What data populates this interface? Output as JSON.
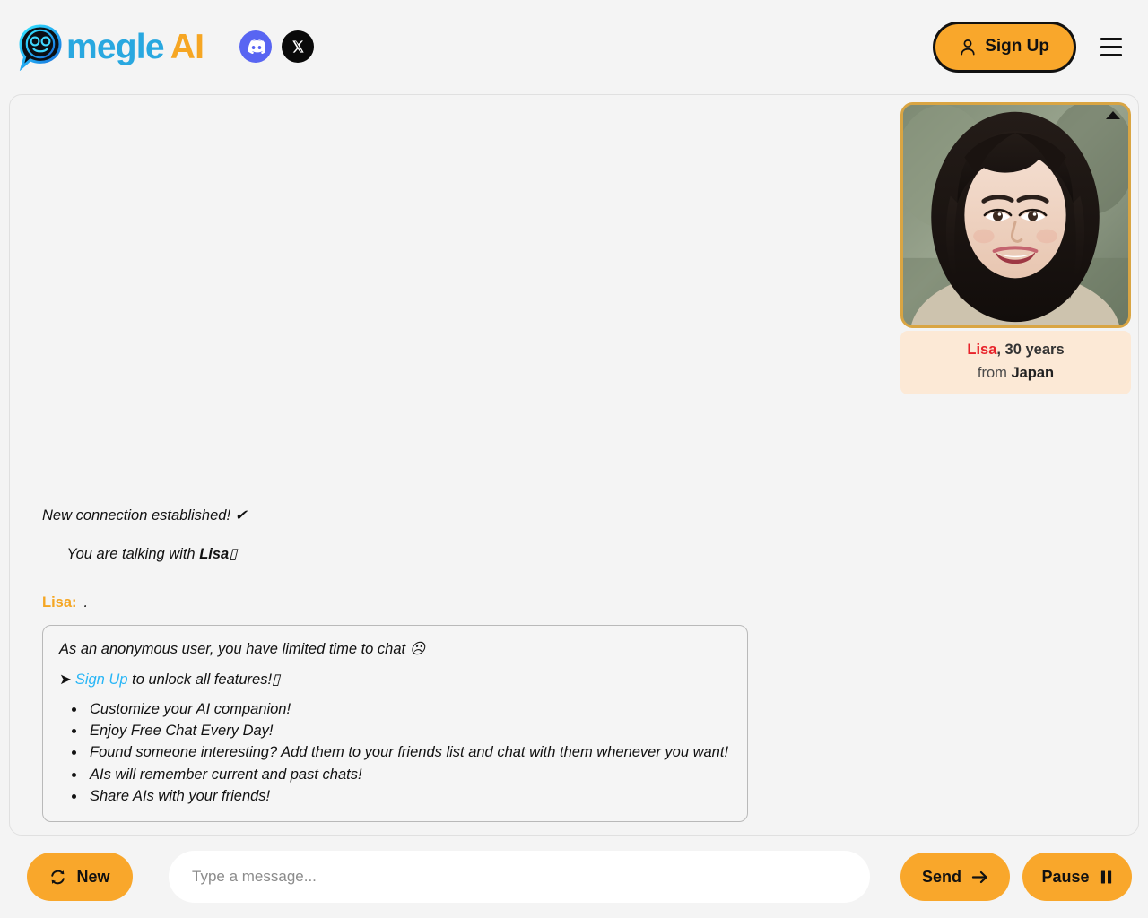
{
  "header": {
    "brand": {
      "logo_icon": "omegle-smiley-speech-bubble-logo",
      "word_primary": "megle",
      "word_accent": "AI"
    },
    "socials": [
      {
        "name": "discord",
        "icon": "discord-icon",
        "label": "Discord"
      },
      {
        "name": "x",
        "icon": "x-twitter-icon",
        "label": "X"
      }
    ],
    "signup": {
      "label": "Sign Up",
      "icon": "user-icon"
    },
    "menu_icon": "hamburger-menu-icon"
  },
  "profile": {
    "photo_alt": "Lisa profile photo",
    "collapse_icon": "triangle-up-icon",
    "name": "Lisa",
    "age_text": ", 30 years",
    "from_prefix": "from ",
    "country": "Japan"
  },
  "chat": {
    "system_line_1": "New connection established! ✔",
    "system_line_2_prefix": "You are talking with ",
    "system_line_2_name": "Lisa",
    "system_line_2_suffix": "▯",
    "peer_label": "Lisa:",
    "peer_message": ".",
    "info_box": {
      "headline": "As an anonymous user, you have limited time to chat ☹",
      "cta_arrow": "➤",
      "cta_link": "Sign Up",
      "cta_rest": " to unlock all features!▯",
      "features": [
        "Customize your AI companion!",
        "Enjoy Free Chat Every Day!",
        "Found someone interesting? Add them to your friends list and chat with them whenever you want!",
        "AIs will remember current and past chats!",
        "Share AIs with your friends!"
      ]
    }
  },
  "controls": {
    "new_label": "New",
    "new_icon": "refresh-icon",
    "input_placeholder": "Type a message...",
    "input_value": "",
    "send_label": "Send",
    "send_icon": "arrow-right-icon",
    "pause_label": "Pause",
    "pause_icon": "pause-icon"
  },
  "colors": {
    "accent_orange": "#f9a72b",
    "brand_blue": "#29a8e0",
    "brand_orange": "#f6a623",
    "link_cyan": "#29b6f6",
    "name_red": "#e8232a",
    "peer_orange": "#f5a623",
    "profile_band": "#fce9d6",
    "profile_border": "#d9a543",
    "page_bg": "#f4f4f4",
    "discord": "#5865f2",
    "x_black": "#0a0a0a"
  }
}
